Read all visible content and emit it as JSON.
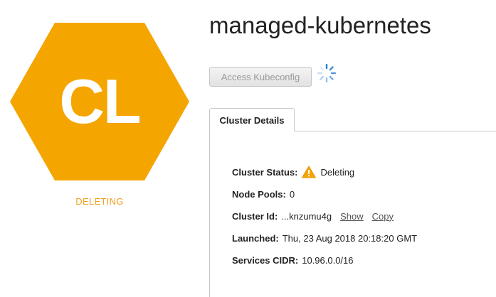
{
  "cluster": {
    "initials": "CL",
    "lifecycle_state": "DELETING",
    "name": "managed-kubernetes"
  },
  "actions": {
    "access_kubeconfig_label": "Access Kubeconfig"
  },
  "tabs": [
    {
      "label": "Cluster Details"
    }
  ],
  "details": {
    "status_label": "Cluster Status:",
    "status_value": "Deleting",
    "node_pools_label": "Node Pools:",
    "node_pools_value": "0",
    "cluster_id_label": "Cluster Id:",
    "cluster_id_value": "...knzumu4g",
    "show_label": "Show",
    "copy_label": "Copy",
    "launched_label": "Launched:",
    "launched_value": "Thu, 23 Aug 2018 20:18:20 GMT",
    "services_cidr_label": "Services CIDR:",
    "services_cidr_value": "10.96.0.0/16"
  },
  "colors": {
    "hexagon": "#f5a500",
    "lifecycle_text": "#f0a020",
    "warning_icon": "#f5a500",
    "spinner": "#2f7fd0"
  },
  "icons": {
    "status": "warning-triangle-icon",
    "loading": "loading-spinner-icon"
  }
}
